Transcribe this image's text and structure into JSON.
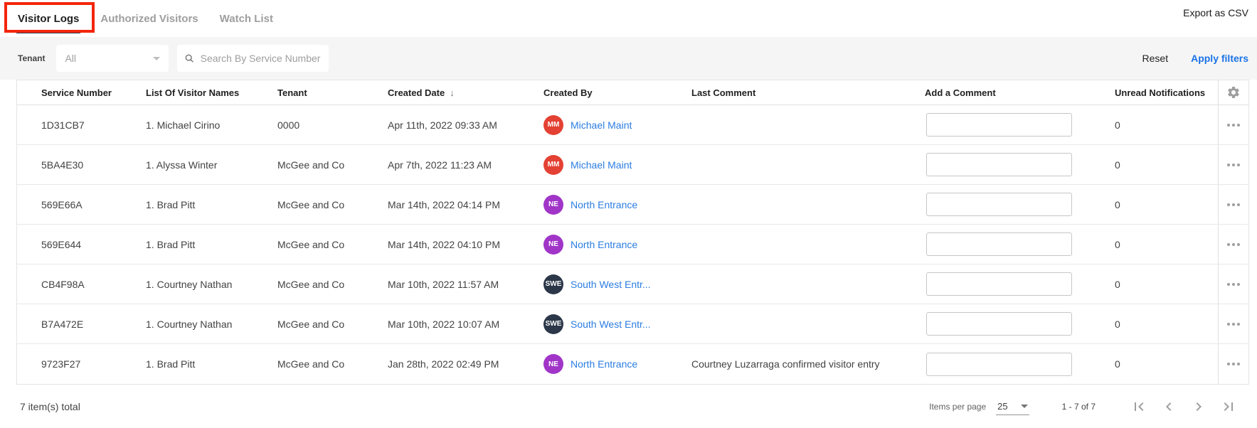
{
  "tabs": {
    "items": [
      {
        "label": "Visitor Logs",
        "active": true
      },
      {
        "label": "Authorized Visitors",
        "active": false
      },
      {
        "label": "Watch List",
        "active": false
      }
    ],
    "export_label": "Export as CSV"
  },
  "annotation": {
    "target": "Visitor Logs tab",
    "color": "#F3260B"
  },
  "filters": {
    "tenant_label": "Tenant",
    "tenant_value": "All",
    "search_placeholder": "Search By Service Number",
    "reset_label": "Reset",
    "apply_label": "Apply filters"
  },
  "table": {
    "columns": [
      "Service Number",
      "List Of Visitor Names",
      "Tenant",
      "Created Date",
      "Created By",
      "Last Comment",
      "Add a Comment",
      "Unread Notifications"
    ],
    "sorted_column": "Created Date",
    "sort_direction": "descending",
    "sort_glyph": "↓",
    "rows": [
      {
        "service_number": "1D31CB7",
        "visitor_names": "1. Michael Cirino",
        "tenant": "0000",
        "created_date": "Apr 11th, 2022 09:33 AM",
        "created_by": {
          "initials": "MM",
          "name": "Michael Maint",
          "color": "#E34133"
        },
        "last_comment": "",
        "comment_value": "",
        "unread": "0"
      },
      {
        "service_number": "5BA4E30",
        "visitor_names": "1. Alyssa Winter",
        "tenant": "McGee and Co",
        "created_date": "Apr 7th, 2022 11:23 AM",
        "created_by": {
          "initials": "MM",
          "name": "Michael Maint",
          "color": "#E34133"
        },
        "last_comment": "",
        "comment_value": "",
        "unread": "0"
      },
      {
        "service_number": "569E66A",
        "visitor_names": "1. Brad Pitt",
        "tenant": "McGee and Co",
        "created_date": "Mar 14th, 2022 04:14 PM",
        "created_by": {
          "initials": "NE",
          "name": "North Entrance",
          "color": "#A035C8"
        },
        "last_comment": "",
        "comment_value": "",
        "unread": "0"
      },
      {
        "service_number": "569E644",
        "visitor_names": "1. Brad Pitt",
        "tenant": "McGee and Co",
        "created_date": "Mar 14th, 2022 04:10 PM",
        "created_by": {
          "initials": "NE",
          "name": "North Entrance",
          "color": "#A035C8"
        },
        "last_comment": "",
        "comment_value": "",
        "unread": "0"
      },
      {
        "service_number": "CB4F98A",
        "visitor_names": "1. Courtney Nathan",
        "tenant": "McGee and Co",
        "created_date": "Mar 10th, 2022 11:57 AM",
        "created_by": {
          "initials": "SWE",
          "name": "South West Entr...",
          "color": "#2C3849"
        },
        "last_comment": "",
        "comment_value": "",
        "unread": "0"
      },
      {
        "service_number": "B7A472E",
        "visitor_names": "1. Courtney Nathan",
        "tenant": "McGee and Co",
        "created_date": "Mar 10th, 2022 10:07 AM",
        "created_by": {
          "initials": "SWE",
          "name": "South West Entr...",
          "color": "#2C3849"
        },
        "last_comment": "",
        "comment_value": "",
        "unread": "0"
      },
      {
        "service_number": "9723F27",
        "visitor_names": "1. Brad Pitt",
        "tenant": "McGee and Co",
        "created_date": "Jan 28th, 2022 02:49 PM",
        "created_by": {
          "initials": "NE",
          "name": "North Entrance",
          "color": "#A035C8"
        },
        "last_comment": "Courtney Luzarraga confirmed visitor entry",
        "comment_value": "",
        "unread": "0"
      }
    ]
  },
  "footer": {
    "total": "7 item(s) total",
    "items_per_page_label": "Items per page",
    "items_per_page_value": "25",
    "range": "1 - 7 of 7"
  },
  "colors": {
    "accent_blue": "#1A73E8",
    "link_blue": "#2B7DE2",
    "annotation_red": "#F3260B",
    "tab_inkbar": "#333F54",
    "filter_band": "#F5F5F5"
  }
}
